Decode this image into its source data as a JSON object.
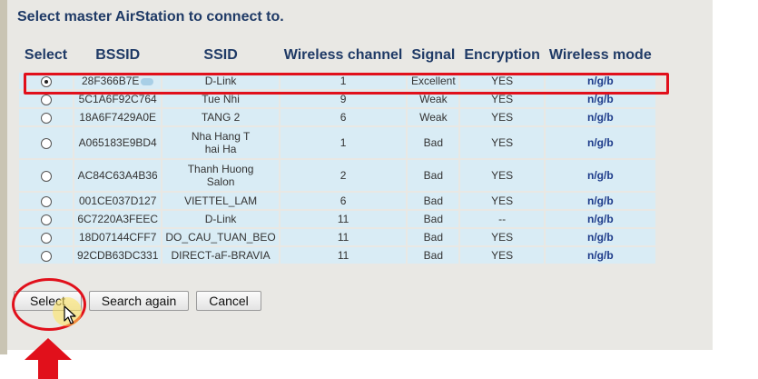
{
  "heading": "Select master AirStation to connect to.",
  "columns": {
    "select": "Select",
    "bssid": "BSSID",
    "ssid": "SSID",
    "channel": "Wireless channel",
    "signal": "Signal",
    "encryption": "Encryption",
    "mode": "Wireless mode"
  },
  "rows": [
    {
      "selected": true,
      "bssid": "28F366B7E",
      "bssid_obscured": true,
      "ssid_lines": [
        "D-Link"
      ],
      "channel": "1",
      "signal": "Excellent",
      "encryption": "YES",
      "mode": "n/g/b"
    },
    {
      "selected": false,
      "bssid": "5C1A6F92C764",
      "ssid_lines": [
        "Tue Nhi"
      ],
      "channel": "9",
      "signal": "Weak",
      "encryption": "YES",
      "mode": "n/g/b"
    },
    {
      "selected": false,
      "bssid": "18A6F7429A0E",
      "ssid_lines": [
        "TANG 2"
      ],
      "channel": "6",
      "signal": "Weak",
      "encryption": "YES",
      "mode": "n/g/b"
    },
    {
      "selected": false,
      "bssid": "A065183E9BD4",
      "ssid_lines": [
        "Nha Hang T",
        "hai Ha"
      ],
      "channel": "1",
      "signal": "Bad",
      "encryption": "YES",
      "mode": "n/g/b"
    },
    {
      "selected": false,
      "bssid": "AC84C63A4B36",
      "ssid_lines": [
        "Thanh Huong",
        "Salon"
      ],
      "channel": "2",
      "signal": "Bad",
      "encryption": "YES",
      "mode": "n/g/b"
    },
    {
      "selected": false,
      "bssid": "001CE037D127",
      "ssid_lines": [
        "VIETTEL_LAM"
      ],
      "channel": "6",
      "signal": "Bad",
      "encryption": "YES",
      "mode": "n/g/b"
    },
    {
      "selected": false,
      "bssid": "6C7220A3FEEC",
      "ssid_lines": [
        "D-Link"
      ],
      "channel": "11",
      "signal": "Bad",
      "encryption": "--",
      "mode": "n/g/b"
    },
    {
      "selected": false,
      "bssid": "18D07144CFF7",
      "ssid_lines": [
        "DO_CAU_TUAN_BEO"
      ],
      "channel": "11",
      "signal": "Bad",
      "encryption": "YES",
      "mode": "n/g/b"
    },
    {
      "selected": false,
      "bssid": "92CDB63DC331",
      "ssid_lines": [
        "DIRECT-aF-BRAVIA"
      ],
      "channel": "11",
      "signal": "Bad",
      "encryption": "YES",
      "mode": "n/g/b"
    }
  ],
  "buttons": {
    "select": "Select",
    "search_again": "Search again",
    "cancel": "Cancel"
  },
  "annotation_color": "#e1101b",
  "icons": [
    "radio-button-icon",
    "mouse-pointer-icon",
    "up-arrow-icon"
  ]
}
